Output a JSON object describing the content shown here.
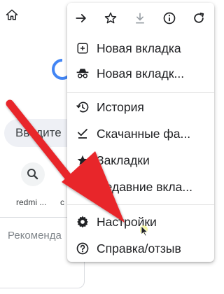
{
  "background": {
    "search_placeholder": "Введите",
    "shortcuts": [
      {
        "label": "redmi ..."
      },
      {
        "label": "c"
      }
    ],
    "recommendations_label": "Рекоменда"
  },
  "menu": {
    "toolbar": [
      {
        "icon": "forward-arrow-icon"
      },
      {
        "icon": "bookmark-star-icon"
      },
      {
        "icon": "download-icon"
      },
      {
        "icon": "info-icon"
      },
      {
        "icon": "refresh-icon"
      }
    ],
    "items": [
      {
        "label": "Новая вкладка",
        "icon": "new-tab-icon"
      },
      {
        "label": "Новая вкладк...",
        "icon": "incognito-icon"
      },
      {
        "label": "История",
        "icon": "history-icon"
      },
      {
        "label": "Скачанные фа...",
        "icon": "downloads-icon"
      },
      {
        "label": "Закладки",
        "icon": "star-icon"
      },
      {
        "label": "Недавние вкла...",
        "icon": "recent-tabs-icon"
      },
      {
        "label": "Настройки",
        "icon": "settings-gear-icon"
      },
      {
        "label": "Справка/отзыв",
        "icon": "help-icon"
      }
    ]
  },
  "colors": {
    "arrow": "#e8252b",
    "menu_text": "#202124",
    "google_blue": "#4285f4",
    "cursor_highlight": "#f3f57a"
  }
}
